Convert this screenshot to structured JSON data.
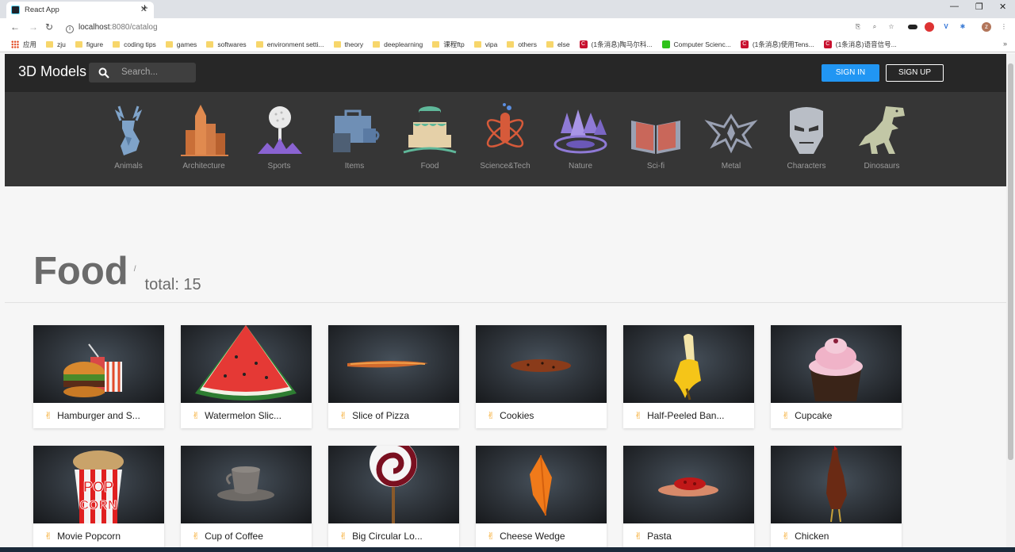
{
  "browser": {
    "tab_title": "React App",
    "new_tab": "+",
    "tab_close": "✕",
    "url_host": "localhost",
    "url_rest": ":8080/catalog",
    "bookmarks": [
      {
        "label": "应用",
        "icon": "apps-icon"
      },
      {
        "label": "zju",
        "icon": "folder-icon"
      },
      {
        "label": "figure",
        "icon": "folder-icon"
      },
      {
        "label": "coding tips",
        "icon": "folder-icon"
      },
      {
        "label": "games",
        "icon": "folder-icon"
      },
      {
        "label": "softwares",
        "icon": "folder-icon"
      },
      {
        "label": "environment setti...",
        "icon": "folder-icon"
      },
      {
        "label": "theory",
        "icon": "folder-icon"
      },
      {
        "label": "deeplearning",
        "icon": "folder-icon"
      },
      {
        "label": "课程ftp",
        "icon": "folder-icon"
      },
      {
        "label": "vipa",
        "icon": "folder-icon"
      },
      {
        "label": "others",
        "icon": "folder-icon"
      },
      {
        "label": "else",
        "icon": "folder-icon"
      },
      {
        "label": "(1条消息)陶马尔科...",
        "icon": "csdn-icon"
      },
      {
        "label": "Computer Scienc...",
        "icon": "green-site-icon"
      },
      {
        "label": "(1条消息)使用Tens...",
        "icon": "csdn-icon"
      },
      {
        "label": "(1条消息)语音信号...",
        "icon": "csdn-icon"
      }
    ],
    "bookmarks_more": "»"
  },
  "app": {
    "brand": "3D Models",
    "search_placeholder": "Search...",
    "sign_in": "SIGN IN",
    "sign_up": "SIGN UP",
    "categories": [
      {
        "label": "Animals",
        "icon": "deer-icon",
        "color": "#7fa3c9"
      },
      {
        "label": "Architecture",
        "icon": "buildings-icon",
        "color": "#d9824a"
      },
      {
        "label": "Sports",
        "icon": "golf-ball-icon",
        "color": "#8a63d2"
      },
      {
        "label": "Items",
        "icon": "briefcase-icon",
        "color": "#6f8fb5"
      },
      {
        "label": "Food",
        "icon": "cake-icon",
        "color": "#5fb89a"
      },
      {
        "label": "Science&Tech",
        "icon": "atom-flask-icon",
        "color": "#d65a3a"
      },
      {
        "label": "Nature",
        "icon": "forest-icon",
        "color": "#8f7ad6"
      },
      {
        "label": "Sci-fi",
        "icon": "open-book-icon",
        "color": "#c9675a"
      },
      {
        "label": "Metal",
        "icon": "metal-emblem-icon",
        "color": "#9aa1b3"
      },
      {
        "label": "Characters",
        "icon": "iron-helmet-icon",
        "color": "#b9bec6"
      },
      {
        "label": "Dinosaurs",
        "icon": "dinosaur-icon",
        "color": "#c2c7a6"
      }
    ],
    "page_title": "Food",
    "slash": "/",
    "total": "total: 15",
    "models": [
      {
        "name": "Hamburger and S...",
        "thumb": "hamburger"
      },
      {
        "name": "Watermelon Slic...",
        "thumb": "watermelon"
      },
      {
        "name": "Slice of Pizza",
        "thumb": "pizza"
      },
      {
        "name": "Cookies",
        "thumb": "cookies"
      },
      {
        "name": "Half-Peeled Ban...",
        "thumb": "banana"
      },
      {
        "name": "Cupcake",
        "thumb": "cupcake"
      },
      {
        "name": "Movie Popcorn",
        "thumb": "popcorn",
        "thumb_text_1": "POP",
        "thumb_text_2": "CORN"
      },
      {
        "name": "Cup of Coffee",
        "thumb": "coffee"
      },
      {
        "name": "Big Circular Lo...",
        "thumb": "lollipop"
      },
      {
        "name": "Cheese Wedge",
        "thumb": "cheese"
      },
      {
        "name": "Pasta",
        "thumb": "pasta"
      },
      {
        "name": "Chicken",
        "thumb": "chicken"
      }
    ]
  }
}
